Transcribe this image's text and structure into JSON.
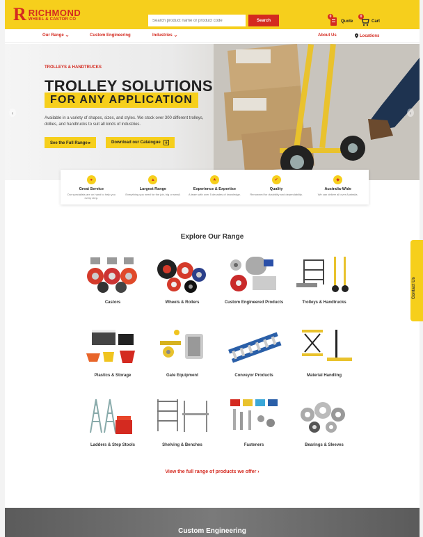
{
  "header": {
    "logo_mark": "R",
    "logo_name": "RICHMOND",
    "logo_sub": "WHEEL & CASTOR CO",
    "search_placeholder": "Search product name or product code",
    "search_label": "Search",
    "quote_label": "Quote",
    "quote_count": "0",
    "cart_label": "Cart",
    "cart_count": "0"
  },
  "nav": {
    "our_range": "Our Range",
    "custom_engineering": "Custom Engineering",
    "industries": "Industries",
    "about_us": "About Us",
    "locations": "Locations"
  },
  "hero": {
    "tag": "TROLLEYS & HANDTRUCKS",
    "title": "TROLLEY SOLUTIONS",
    "subtitle": "FOR ANY APPLICATION",
    "description": "Available in a variety of shapes, sizes, and styles. We stock over 300 different trolleys, dollies, and handtrucks to suit all kinds of industries.",
    "btn_range": "See the Full Range ▸",
    "btn_catalogue": "Download our Catalogue"
  },
  "features": [
    {
      "title": "Great Service",
      "desc": "Our specialists are on hand to help you every step."
    },
    {
      "title": "Largest Range",
      "desc": "Everything you need for the job, big or small."
    },
    {
      "title": "Experience & Expertise",
      "desc": "A team with over 5 decades of knowledge."
    },
    {
      "title": "Quality",
      "desc": "Renowned for durability and dependability."
    },
    {
      "title": "Australia-Wide",
      "desc": "We can deliver all over Australia."
    }
  ],
  "range": {
    "title": "Explore Our Range",
    "items": [
      "Castors",
      "Wheels & Rollers",
      "Custom Engineered Products",
      "Trolleys & Handtrucks",
      "Plastics & Storage",
      "Gate Equipment",
      "Conveyor Products",
      "Material Handling",
      "Ladders & Step Stools",
      "Shelving & Benches",
      "Fasteners",
      "Bearings & Sleeves"
    ],
    "view_all": "View the full range of products we offer ›"
  },
  "custom_section": {
    "title": "Custom Engineering"
  },
  "contact_tab": "Contact Us",
  "colors": {
    "brand_yellow": "#f6cf1c",
    "brand_red": "#d42a20"
  }
}
